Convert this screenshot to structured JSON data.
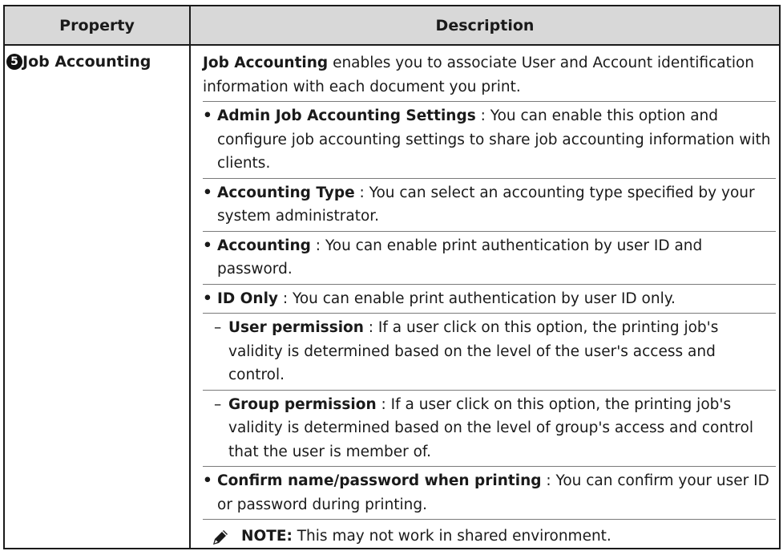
{
  "header": {
    "col_property": "Property",
    "col_description": "Description"
  },
  "row": {
    "number": "5",
    "property": "Job Accounting",
    "intro_bold": "Job Accounting",
    "intro_rest": " enables you to associate User and Account identification information with each document you print.",
    "items": [
      {
        "term": "Admin Job Accounting Settings",
        "text": " : You can enable this option and configure job accounting settings to share job accounting information with clients."
      },
      {
        "term": "Accounting Type",
        "text": " : You can select an accounting type specified by your system administrator."
      },
      {
        "term": "Accounting",
        "text": " : You can enable print authentication by user ID and password."
      },
      {
        "term": "ID Only",
        "text": " : You can enable print authentication by user ID only."
      }
    ],
    "subitems": [
      {
        "term": "User permission",
        "text": " : If a user click on this option, the printing job's validity is determined based on the level of the user's access and control."
      },
      {
        "term": "Group permission",
        "text": " : If a user click on this option, the printing job's validity is determined based on the level of group's access and control that the user is member of."
      }
    ],
    "last_item": {
      "term": "Confirm name/password when printing",
      "text": "  : You can confirm your user ID or password during printing."
    },
    "note": {
      "label": "NOTE:",
      "text": " This may not work in shared environment."
    }
  }
}
